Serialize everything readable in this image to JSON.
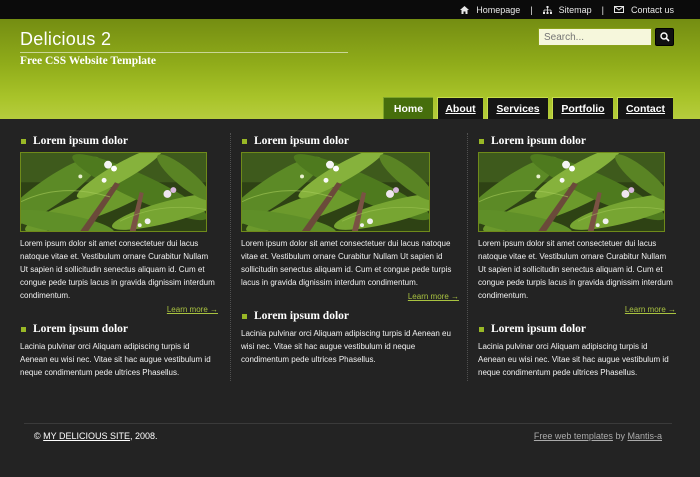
{
  "topbar": {
    "links": [
      {
        "label": "Homepage",
        "icon": "home-icon"
      },
      {
        "label": "Sitemap",
        "icon": "sitemap-icon"
      },
      {
        "label": "Contact us",
        "icon": "mail-icon"
      }
    ],
    "separator": "|"
  },
  "header": {
    "title": "Delicious 2",
    "subtitle": "Free CSS Website Template",
    "search_placeholder": "Search...",
    "search_button_icon": "search-icon"
  },
  "nav": {
    "tabs": [
      {
        "label": "Home",
        "active": true
      },
      {
        "label": "About",
        "active": false
      },
      {
        "label": "Services",
        "active": false
      },
      {
        "label": "Portfolio",
        "active": false
      },
      {
        "label": "Contact",
        "active": false
      }
    ]
  },
  "columns": [
    {
      "sections": [
        {
          "heading": "Lorem ipsum dolor",
          "image": "plant-photo",
          "text": "Lorem ipsum dolor sit amet consectetuer dui lacus natoque vitae et. Vestibulum ornare Curabitur Nullam Ut sapien id sollicitudin senectus aliquam id. Cum et congue pede turpis lacus in gravida dignissim interdum condimentum.",
          "more": "Learn more →"
        },
        {
          "heading": "Lorem ipsum dolor",
          "text": "Lacinia pulvinar orci Aliquam adipiscing turpis id Aenean eu wisi nec. Vitae sit hac augue vestibulum id neque condimentum pede ultrices Phasellus."
        }
      ]
    },
    {
      "sections": [
        {
          "heading": "Lorem ipsum dolor",
          "image": "plant-photo",
          "text": "Lorem ipsum dolor sit amet consectetuer dui lacus natoque vitae et. Vestibulum ornare Curabitur Nullam Ut sapien id sollicitudin senectus aliquam id. Cum et congue pede turpis lacus in gravida dignissim interdum condimentum.",
          "more": "Learn more →"
        },
        {
          "heading": "Lorem ipsum dolor",
          "text": "Lacinia pulvinar orci Aliquam adipiscing turpis id Aenean eu wisi nec. Vitae sit hac augue vestibulum id neque condimentum pede ultrices Phasellus."
        }
      ]
    },
    {
      "sections": [
        {
          "heading": "Lorem ipsum dolor",
          "image": "plant-photo",
          "text": "Lorem ipsum dolor sit amet consectetuer dui lacus natoque vitae et. Vestibulum ornare Curabitur Nullam Ut sapien id sollicitudin senectus aliquam id. Cum et congue pede turpis lacus in gravida dignissim interdum condimentum.",
          "more": "Learn more →"
        },
        {
          "heading": "Lorem ipsum dolor",
          "text": "Lacinia pulvinar orci Aliquam adipiscing turpis id Aenean eu wisi nec. Vitae sit hac augue vestibulum id neque condimentum pede ultrices Phasellus."
        }
      ]
    }
  ],
  "footer": {
    "copyright_symbol": "©",
    "site_link": "MY DELICIOUS SITE",
    "year_text": ", 2008.",
    "templates_link": "Free web templates",
    "by_text": "by",
    "author_link": "Mantis-a"
  },
  "colors": {
    "accent_green": "#99b826",
    "header_green": "#90ac1a",
    "background": "#232323",
    "active_tab": "#466e0c"
  }
}
